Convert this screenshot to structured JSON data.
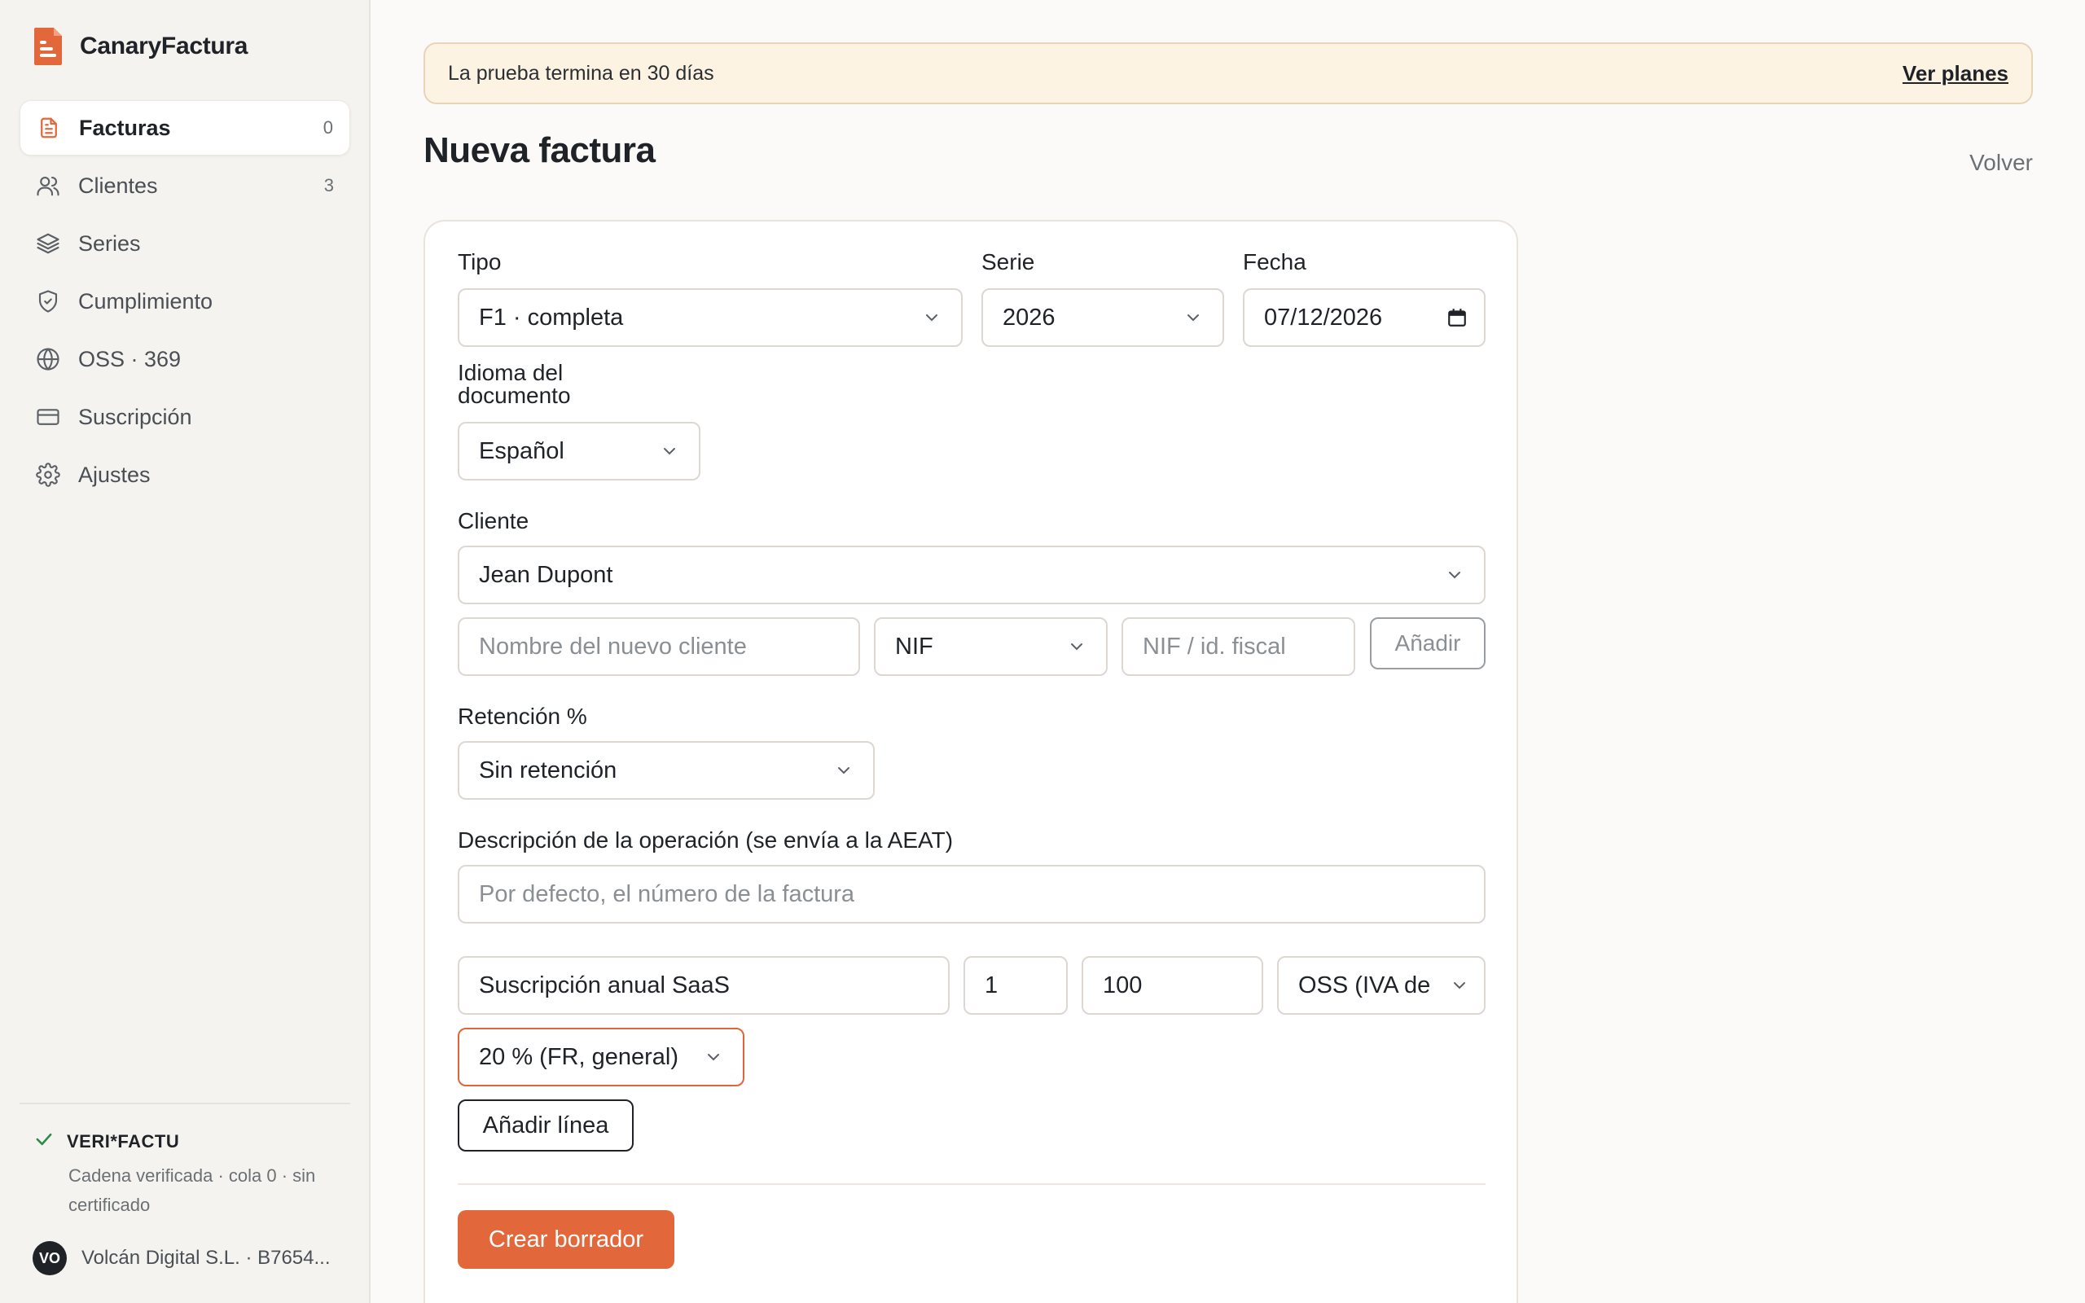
{
  "brand": {
    "name": "CanaryFactura",
    "accent": "#e2683c"
  },
  "sidebar": {
    "items": [
      {
        "label": "Facturas",
        "count": "0",
        "icon": "file-text-icon",
        "active": true
      },
      {
        "label": "Clientes",
        "count": "3",
        "icon": "users-icon"
      },
      {
        "label": "Series",
        "icon": "layers-icon"
      },
      {
        "label": "Cumplimiento",
        "icon": "shield-check-icon"
      },
      {
        "label": "OSS · 369",
        "icon": "globe-icon"
      },
      {
        "label": "Suscripción",
        "icon": "credit-card-icon"
      },
      {
        "label": "Ajustes",
        "icon": "gear-icon"
      }
    ],
    "verifactu": {
      "title": "VERI*FACTU",
      "subtitle": "Cadena verificada · cola 0 · sin certificado",
      "icon": "check-icon"
    },
    "account": {
      "initials": "VO",
      "name": "Volcán Digital S.L. · B7654..."
    }
  },
  "banner": {
    "text": "La prueba termina en 30 días",
    "link": "Ver planes"
  },
  "page": {
    "title": "Nueva factura",
    "back": "Volver"
  },
  "form": {
    "tipo": {
      "label": "Tipo",
      "value": "F1 · completa"
    },
    "serie": {
      "label": "Serie",
      "value": "2026"
    },
    "fecha": {
      "label": "Fecha",
      "value": "07/12/2026"
    },
    "idioma": {
      "label": "Idioma del documento",
      "value": "Español"
    },
    "cliente": {
      "label": "Cliente",
      "value": "Jean Dupont"
    },
    "nuevo_cliente": {
      "name_placeholder": "Nombre del nuevo cliente",
      "id_type": "NIF",
      "id_placeholder": "NIF / id. fiscal",
      "add_label": "Añadir"
    },
    "retencion": {
      "label": "Retención %",
      "value": "Sin retención"
    },
    "descripcion": {
      "label": "Descripción de la operación (se envía a la AEAT)",
      "placeholder": "Por defecto, el número de la factura"
    },
    "linea": {
      "concepto": "Suscripción anual SaaS",
      "cantidad": "1",
      "precio": "100",
      "regimen": "OSS (IVA de",
      "tipo_iva": "20 % (FR, general)"
    },
    "add_line": "Añadir línea",
    "submit": "Crear borrador"
  }
}
